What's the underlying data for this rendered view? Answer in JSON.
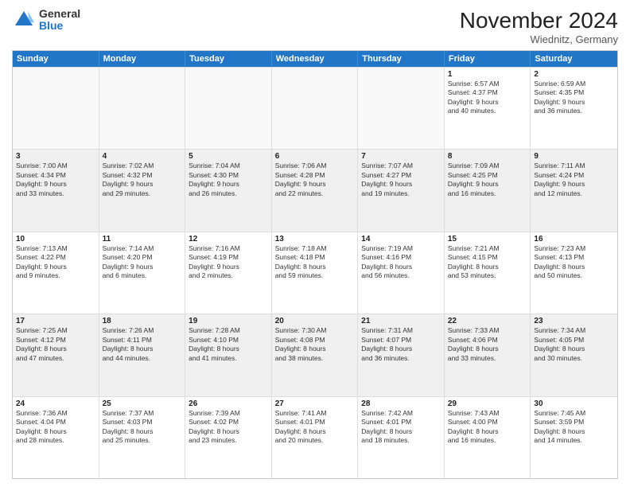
{
  "logo": {
    "general": "General",
    "blue": "Blue"
  },
  "header": {
    "month": "November 2024",
    "location": "Wiednitz, Germany"
  },
  "weekdays": [
    "Sunday",
    "Monday",
    "Tuesday",
    "Wednesday",
    "Thursday",
    "Friday",
    "Saturday"
  ],
  "weeks": [
    [
      {
        "day": "",
        "detail": "",
        "empty": true
      },
      {
        "day": "",
        "detail": "",
        "empty": true
      },
      {
        "day": "",
        "detail": "",
        "empty": true
      },
      {
        "day": "",
        "detail": "",
        "empty": true
      },
      {
        "day": "",
        "detail": "",
        "empty": true
      },
      {
        "day": "1",
        "detail": "Sunrise: 6:57 AM\nSunset: 4:37 PM\nDaylight: 9 hours\nand 40 minutes.",
        "empty": false
      },
      {
        "day": "2",
        "detail": "Sunrise: 6:59 AM\nSunset: 4:35 PM\nDaylight: 9 hours\nand 36 minutes.",
        "empty": false
      }
    ],
    [
      {
        "day": "3",
        "detail": "Sunrise: 7:00 AM\nSunset: 4:34 PM\nDaylight: 9 hours\nand 33 minutes.",
        "empty": false
      },
      {
        "day": "4",
        "detail": "Sunrise: 7:02 AM\nSunset: 4:32 PM\nDaylight: 9 hours\nand 29 minutes.",
        "empty": false
      },
      {
        "day": "5",
        "detail": "Sunrise: 7:04 AM\nSunset: 4:30 PM\nDaylight: 9 hours\nand 26 minutes.",
        "empty": false
      },
      {
        "day": "6",
        "detail": "Sunrise: 7:06 AM\nSunset: 4:28 PM\nDaylight: 9 hours\nand 22 minutes.",
        "empty": false
      },
      {
        "day": "7",
        "detail": "Sunrise: 7:07 AM\nSunset: 4:27 PM\nDaylight: 9 hours\nand 19 minutes.",
        "empty": false
      },
      {
        "day": "8",
        "detail": "Sunrise: 7:09 AM\nSunset: 4:25 PM\nDaylight: 9 hours\nand 16 minutes.",
        "empty": false
      },
      {
        "day": "9",
        "detail": "Sunrise: 7:11 AM\nSunset: 4:24 PM\nDaylight: 9 hours\nand 12 minutes.",
        "empty": false
      }
    ],
    [
      {
        "day": "10",
        "detail": "Sunrise: 7:13 AM\nSunset: 4:22 PM\nDaylight: 9 hours\nand 9 minutes.",
        "empty": false
      },
      {
        "day": "11",
        "detail": "Sunrise: 7:14 AM\nSunset: 4:20 PM\nDaylight: 9 hours\nand 6 minutes.",
        "empty": false
      },
      {
        "day": "12",
        "detail": "Sunrise: 7:16 AM\nSunset: 4:19 PM\nDaylight: 9 hours\nand 2 minutes.",
        "empty": false
      },
      {
        "day": "13",
        "detail": "Sunrise: 7:18 AM\nSunset: 4:18 PM\nDaylight: 8 hours\nand 59 minutes.",
        "empty": false
      },
      {
        "day": "14",
        "detail": "Sunrise: 7:19 AM\nSunset: 4:16 PM\nDaylight: 8 hours\nand 56 minutes.",
        "empty": false
      },
      {
        "day": "15",
        "detail": "Sunrise: 7:21 AM\nSunset: 4:15 PM\nDaylight: 8 hours\nand 53 minutes.",
        "empty": false
      },
      {
        "day": "16",
        "detail": "Sunrise: 7:23 AM\nSunset: 4:13 PM\nDaylight: 8 hours\nand 50 minutes.",
        "empty": false
      }
    ],
    [
      {
        "day": "17",
        "detail": "Sunrise: 7:25 AM\nSunset: 4:12 PM\nDaylight: 8 hours\nand 47 minutes.",
        "empty": false
      },
      {
        "day": "18",
        "detail": "Sunrise: 7:26 AM\nSunset: 4:11 PM\nDaylight: 8 hours\nand 44 minutes.",
        "empty": false
      },
      {
        "day": "19",
        "detail": "Sunrise: 7:28 AM\nSunset: 4:10 PM\nDaylight: 8 hours\nand 41 minutes.",
        "empty": false
      },
      {
        "day": "20",
        "detail": "Sunrise: 7:30 AM\nSunset: 4:08 PM\nDaylight: 8 hours\nand 38 minutes.",
        "empty": false
      },
      {
        "day": "21",
        "detail": "Sunrise: 7:31 AM\nSunset: 4:07 PM\nDaylight: 8 hours\nand 36 minutes.",
        "empty": false
      },
      {
        "day": "22",
        "detail": "Sunrise: 7:33 AM\nSunset: 4:06 PM\nDaylight: 8 hours\nand 33 minutes.",
        "empty": false
      },
      {
        "day": "23",
        "detail": "Sunrise: 7:34 AM\nSunset: 4:05 PM\nDaylight: 8 hours\nand 30 minutes.",
        "empty": false
      }
    ],
    [
      {
        "day": "24",
        "detail": "Sunrise: 7:36 AM\nSunset: 4:04 PM\nDaylight: 8 hours\nand 28 minutes.",
        "empty": false
      },
      {
        "day": "25",
        "detail": "Sunrise: 7:37 AM\nSunset: 4:03 PM\nDaylight: 8 hours\nand 25 minutes.",
        "empty": false
      },
      {
        "day": "26",
        "detail": "Sunrise: 7:39 AM\nSunset: 4:02 PM\nDaylight: 8 hours\nand 23 minutes.",
        "empty": false
      },
      {
        "day": "27",
        "detail": "Sunrise: 7:41 AM\nSunset: 4:01 PM\nDaylight: 8 hours\nand 20 minutes.",
        "empty": false
      },
      {
        "day": "28",
        "detail": "Sunrise: 7:42 AM\nSunset: 4:01 PM\nDaylight: 8 hours\nand 18 minutes.",
        "empty": false
      },
      {
        "day": "29",
        "detail": "Sunrise: 7:43 AM\nSunset: 4:00 PM\nDaylight: 8 hours\nand 16 minutes.",
        "empty": false
      },
      {
        "day": "30",
        "detail": "Sunrise: 7:45 AM\nSunset: 3:59 PM\nDaylight: 8 hours\nand 14 minutes.",
        "empty": false
      }
    ]
  ]
}
